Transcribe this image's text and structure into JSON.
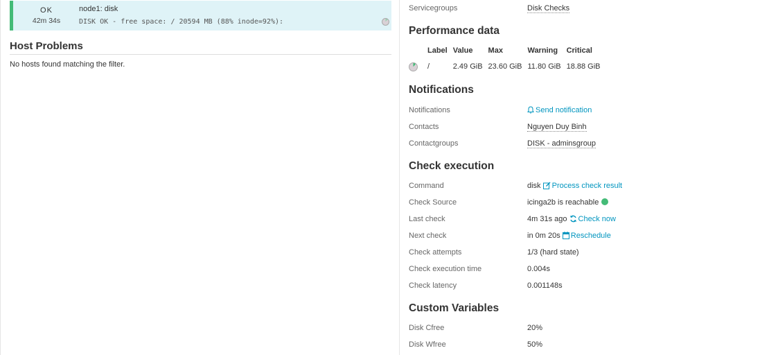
{
  "service": {
    "state": "OK",
    "duration": "42m 34s",
    "name": "node1: disk",
    "output": "DISK OK - free space: / 20594 MB (88% inode=92%):"
  },
  "host_problems": {
    "title": "Host Problems",
    "empty_message": "No hosts found matching the filter."
  },
  "servicegroups": {
    "label": "Servicegroups",
    "value": "Disk Checks"
  },
  "performance": {
    "title": "Performance data",
    "headers": [
      "Label",
      "Value",
      "Max",
      "Warning",
      "Critical"
    ],
    "rows": [
      {
        "label": "/",
        "value": "2.49 GiB",
        "max": "23.60 GiB",
        "warning": "11.80 GiB",
        "critical": "18.88 GiB"
      }
    ]
  },
  "notifications": {
    "title": "Notifications",
    "rows": {
      "notifications": {
        "label": "Notifications",
        "action": "Send notification"
      },
      "contacts": {
        "label": "Contacts",
        "value": "Nguyen Duy Binh"
      },
      "contactgroups": {
        "label": "Contactgroups",
        "value": "DISK - adminsgroup"
      }
    }
  },
  "check_execution": {
    "title": "Check execution",
    "command": {
      "label": "Command",
      "value": "disk",
      "action": "Process check result"
    },
    "check_source": {
      "label": "Check Source",
      "value": "icinga2b is reachable"
    },
    "last_check": {
      "label": "Last check",
      "value": "4m 31s ago",
      "action": "Check now"
    },
    "next_check": {
      "label": "Next check",
      "value": "in 0m 20s",
      "action": "Reschedule"
    },
    "attempts": {
      "label": "Check attempts",
      "value": "1/3 (hard state)"
    },
    "exec_time": {
      "label": "Check execution time",
      "value": "0.004s"
    },
    "latency": {
      "label": "Check latency",
      "value": "0.001148s"
    }
  },
  "custom_variables": {
    "title": "Custom Variables",
    "rows": [
      {
        "label": "Disk Cfree",
        "value": "20%"
      },
      {
        "label": "Disk Wfree",
        "value": "50%"
      }
    ]
  },
  "colors": {
    "ok": "#44bb77",
    "link": "#0095bf",
    "row_bg": "#dff3f7"
  }
}
